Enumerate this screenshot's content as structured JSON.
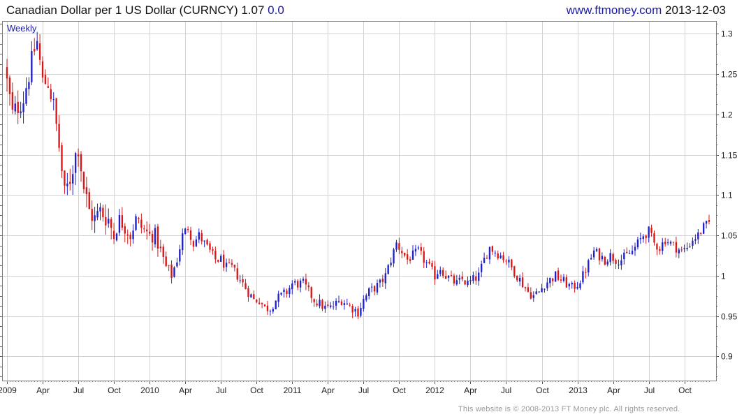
{
  "header": {
    "title": "Canadian Dollar per 1 US Dollar (CURNCY)",
    "last": "1.07",
    "change": "0.0",
    "website": "www.ftmoney.com",
    "date": "2013-12-03"
  },
  "footer": "This website is © 2008-2013 FT Money plc. All rights reserved.",
  "colors": {
    "up": "#2020c8",
    "down": "#d81818",
    "grid": "#d2d2d2",
    "label_blue": "#1a1aa8"
  },
  "chart_data": {
    "type": "candlestick",
    "period_label": "Weekly",
    "x_unit": "weeks from first candle (week of 2009-01-02)",
    "x_ticks": [
      {
        "label": "2009",
        "week": 0
      },
      {
        "label": "Apr",
        "week": 13
      },
      {
        "label": "Jul",
        "week": 26
      },
      {
        "label": "Oct",
        "week": 39
      },
      {
        "label": "2010",
        "week": 52
      },
      {
        "label": "Apr",
        "week": 65
      },
      {
        "label": "Jul",
        "week": 78
      },
      {
        "label": "Oct",
        "week": 91
      },
      {
        "label": "2011",
        "week": 104
      },
      {
        "label": "Apr",
        "week": 117
      },
      {
        "label": "Jul",
        "week": 130
      },
      {
        "label": "Oct",
        "week": 143
      },
      {
        "label": "2012",
        "week": 156
      },
      {
        "label": "Apr",
        "week": 169
      },
      {
        "label": "Jul",
        "week": 182
      },
      {
        "label": "Oct",
        "week": 195
      },
      {
        "label": "2013",
        "week": 208
      },
      {
        "label": "Apr",
        "week": 221
      },
      {
        "label": "Jul",
        "week": 234
      },
      {
        "label": "Oct",
        "week": 247
      }
    ],
    "y_ticks": [
      "0.9",
      "0.95",
      "1",
      "1.05",
      "1.1",
      "1.15",
      "1.2",
      "1.25",
      "1.3"
    ],
    "ylim": [
      0.87,
      1.315
    ],
    "grid": true,
    "close_anchors": [
      [
        0,
        1.24
      ],
      [
        2,
        1.2
      ],
      [
        4,
        1.21
      ],
      [
        6,
        1.22
      ],
      [
        8,
        1.25
      ],
      [
        10,
        1.28
      ],
      [
        11,
        1.29
      ],
      [
        13,
        1.24
      ],
      [
        15,
        1.24
      ],
      [
        17,
        1.21
      ],
      [
        19,
        1.16
      ],
      [
        21,
        1.1
      ],
      [
        23,
        1.12
      ],
      [
        25,
        1.15
      ],
      [
        26,
        1.16
      ],
      [
        28,
        1.11
      ],
      [
        30,
        1.08
      ],
      [
        32,
        1.07
      ],
      [
        34,
        1.08
      ],
      [
        37,
        1.07
      ],
      [
        39,
        1.05
      ],
      [
        41,
        1.07
      ],
      [
        43,
        1.06
      ],
      [
        45,
        1.05
      ],
      [
        47,
        1.07
      ],
      [
        49,
        1.06
      ],
      [
        52,
        1.05
      ],
      [
        54,
        1.05
      ],
      [
        56,
        1.03
      ],
      [
        58,
        1.01
      ],
      [
        60,
        1.0
      ],
      [
        62,
        1.02
      ],
      [
        64,
        1.05
      ],
      [
        66,
        1.06
      ],
      [
        68,
        1.04
      ],
      [
        70,
        1.05
      ],
      [
        72,
        1.04
      ],
      [
        74,
        1.03
      ],
      [
        76,
        1.02
      ],
      [
        78,
        1.02
      ],
      [
        80,
        1.01
      ],
      [
        82,
        1.01
      ],
      [
        84,
        1.0
      ],
      [
        86,
        0.99
      ],
      [
        88,
        0.98
      ],
      [
        90,
        0.97
      ],
      [
        92,
        0.97
      ],
      [
        94,
        0.96
      ],
      [
        96,
        0.96
      ],
      [
        98,
        0.97
      ],
      [
        100,
        0.975
      ],
      [
        102,
        0.98
      ],
      [
        104,
        0.99
      ],
      [
        106,
        0.99
      ],
      [
        108,
        0.99
      ],
      [
        110,
        0.98
      ],
      [
        112,
        0.97
      ],
      [
        114,
        0.965
      ],
      [
        116,
        0.96
      ],
      [
        118,
        0.96
      ],
      [
        120,
        0.965
      ],
      [
        122,
        0.97
      ],
      [
        124,
        0.965
      ],
      [
        126,
        0.96
      ],
      [
        128,
        0.955
      ],
      [
        130,
        0.97
      ],
      [
        132,
        0.98
      ],
      [
        134,
        0.985
      ],
      [
        136,
        0.99
      ],
      [
        138,
        1.0
      ],
      [
        140,
        1.02
      ],
      [
        142,
        1.04
      ],
      [
        144,
        1.03
      ],
      [
        146,
        1.02
      ],
      [
        148,
        1.025
      ],
      [
        150,
        1.03
      ],
      [
        152,
        1.02
      ],
      [
        154,
        1.01
      ],
      [
        156,
        1.0
      ],
      [
        158,
        1.01
      ],
      [
        160,
        1.0
      ],
      [
        162,
        0.995
      ],
      [
        164,
        0.99
      ],
      [
        166,
        0.995
      ],
      [
        168,
        0.99
      ],
      [
        170,
        0.995
      ],
      [
        172,
        1.0
      ],
      [
        174,
        1.02
      ],
      [
        176,
        1.035
      ],
      [
        178,
        1.03
      ],
      [
        180,
        1.025
      ],
      [
        182,
        1.02
      ],
      [
        184,
        1.01
      ],
      [
        186,
        1.0
      ],
      [
        188,
        0.99
      ],
      [
        190,
        0.98
      ],
      [
        192,
        0.975
      ],
      [
        194,
        0.98
      ],
      [
        196,
        0.99
      ],
      [
        198,
        0.995
      ],
      [
        200,
        1.0
      ],
      [
        202,
        0.995
      ],
      [
        204,
        0.99
      ],
      [
        206,
        0.985
      ],
      [
        208,
        0.99
      ],
      [
        210,
        1.0
      ],
      [
        212,
        1.015
      ],
      [
        214,
        1.03
      ],
      [
        216,
        1.025
      ],
      [
        218,
        1.02
      ],
      [
        220,
        1.025
      ],
      [
        222,
        1.02
      ],
      [
        224,
        1.02
      ],
      [
        226,
        1.025
      ],
      [
        228,
        1.03
      ],
      [
        230,
        1.04
      ],
      [
        232,
        1.05
      ],
      [
        234,
        1.055
      ],
      [
        236,
        1.04
      ],
      [
        238,
        1.035
      ],
      [
        240,
        1.045
      ],
      [
        242,
        1.04
      ],
      [
        244,
        1.035
      ],
      [
        246,
        1.03
      ],
      [
        248,
        1.035
      ],
      [
        250,
        1.045
      ],
      [
        252,
        1.05
      ],
      [
        254,
        1.06
      ],
      [
        256,
        1.065
      ]
    ]
  }
}
